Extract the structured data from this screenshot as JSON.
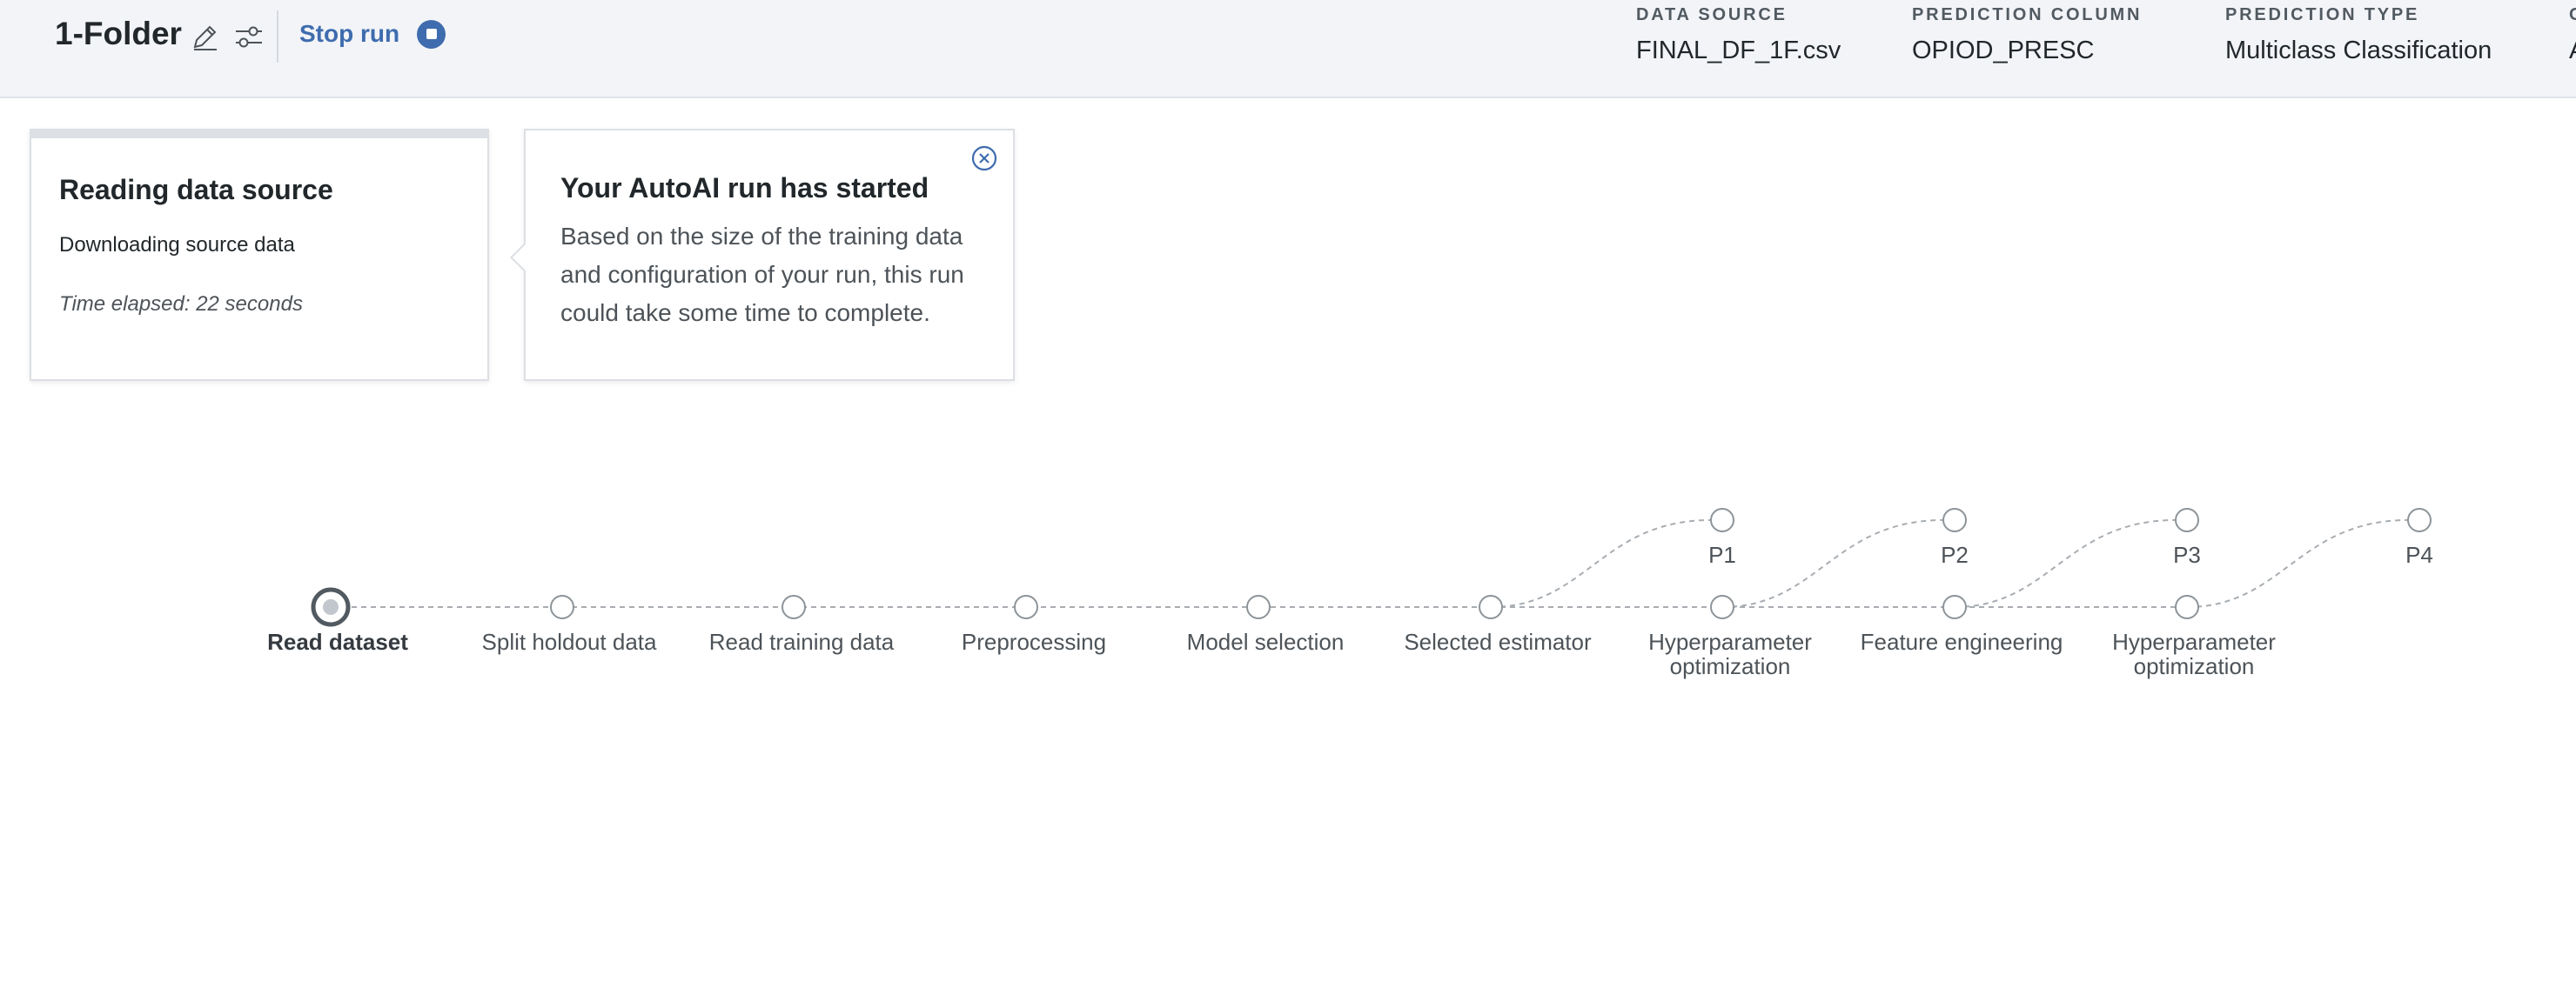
{
  "header": {
    "project_title": "1-Folder",
    "stop_run_label": "Stop run",
    "meta": [
      {
        "label": "DATA SOURCE",
        "value": "FINAL_DF_1F.csv"
      },
      {
        "label": "PREDICTION COLUMN",
        "value": "OPIOD_PRESC"
      },
      {
        "label": "PREDICTION TYPE",
        "value": "Multiclass Classification"
      },
      {
        "label": "O",
        "value": "A"
      }
    ]
  },
  "status_card": {
    "title": "Reading data source",
    "subtitle": "Downloading source data",
    "time_elapsed": "Time elapsed: 22 seconds"
  },
  "notice_card": {
    "title": "Your AutoAI run has started",
    "body": "Based on the size of the training data and configuration of your run, this run could take some time to complete."
  },
  "pipeline": {
    "steps": [
      {
        "label": "Read dataset",
        "state": "active"
      },
      {
        "label": "Split holdout data",
        "state": "pending"
      },
      {
        "label": "Read training data",
        "state": "pending"
      },
      {
        "label": "Preprocessing",
        "state": "pending"
      },
      {
        "label": "Model selection",
        "state": "pending"
      },
      {
        "label": "Selected estimator",
        "state": "pending"
      },
      {
        "label": "Hyperparameter optimization",
        "state": "pending"
      },
      {
        "label": "Feature engineering",
        "state": "pending"
      },
      {
        "label": "Hyperparameter optimization",
        "state": "pending"
      }
    ],
    "pipelines": [
      "P1",
      "P2",
      "P3",
      "P4"
    ]
  },
  "colors": {
    "accent": "#3e6cae",
    "header_bg": "#f2f4f8",
    "node_stroke": "#8d9499",
    "active_node": "#525a61"
  }
}
